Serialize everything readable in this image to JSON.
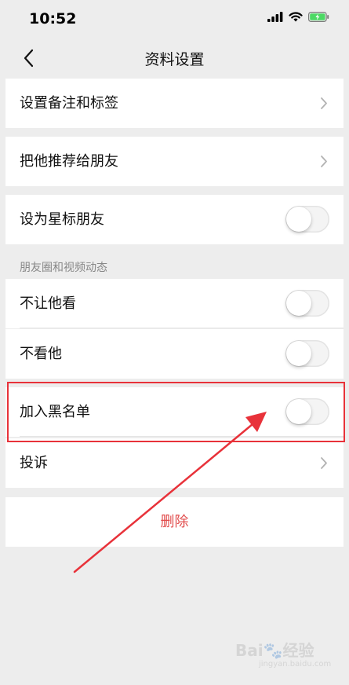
{
  "status": {
    "time": "10:52"
  },
  "nav": {
    "title": "资料设置"
  },
  "rows": {
    "remark": "设置备注和标签",
    "recommend": "把他推荐给朋友",
    "star": "设为星标朋友",
    "section": "朋友圈和视频动态",
    "hide_from": "不让他看",
    "hide_his": "不看他",
    "blacklist": "加入黑名单",
    "report": "投诉",
    "delete": "删除"
  },
  "toggles": {
    "star": false,
    "hide_from": false,
    "hide_his": false,
    "blacklist": false
  },
  "colors": {
    "accent_red": "#e14b4b",
    "annotation_red": "#e8323a",
    "background": "#ededed"
  },
  "watermark": {
    "brand": "Bai",
    "brand_suffix": "经验",
    "url": "jingyan.baidu.com"
  }
}
